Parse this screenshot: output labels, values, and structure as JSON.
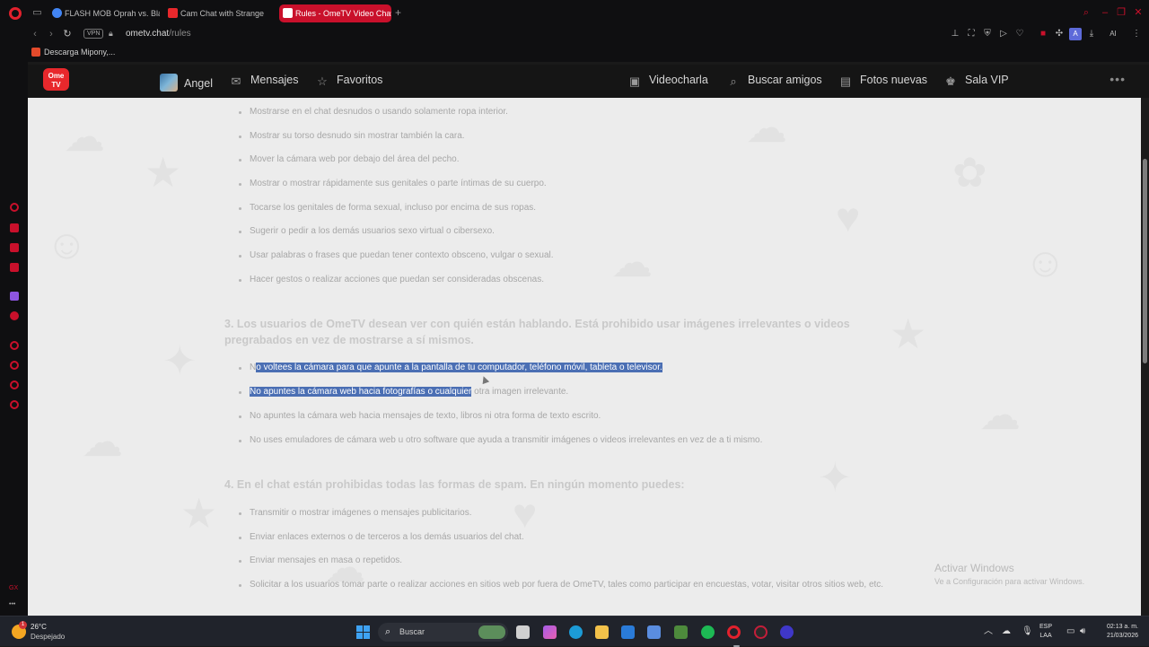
{
  "browser": {
    "tabs": [
      {
        "title": "FLASH MOB Oprah vs. Bla",
        "favicon_color": "#4285f4",
        "active": false
      },
      {
        "title": "Cam Chat with Strange",
        "favicon_color": "#e8282c",
        "active": false
      },
      {
        "title": "Rules - OmeTV Video Chat",
        "favicon_color": "#ffffff",
        "active": true
      }
    ],
    "new_tab": "+",
    "address": {
      "vpn": "VPN",
      "host": "ometv.chat",
      "path": "/rules"
    },
    "bookmark": "Descarga Mipony,...",
    "profile_initial": "A",
    "ai_label": "AI",
    "sidebar_label": "GX"
  },
  "site": {
    "logo": {
      "line1": "Ome",
      "line2": "TV"
    },
    "nav_left": [
      {
        "label": "Angel"
      },
      {
        "label": "Mensajes"
      },
      {
        "label": "Favoritos"
      }
    ],
    "nav_right": [
      {
        "label": "Videocharla"
      },
      {
        "label": "Buscar amigos"
      },
      {
        "label": "Fotos nuevas"
      },
      {
        "label": "Sala VIP"
      }
    ],
    "more": "•••"
  },
  "rules": {
    "list_a": [
      "Mostrarse en el chat desnudos o usando solamente ropa interior.",
      "Mostrar su torso desnudo sin mostrar también la cara.",
      "Mover la cámara web por debajo del área del pecho.",
      "Mostrar o mostrar rápidamente sus genitales o parte íntimas de su cuerpo.",
      "Tocarse los genitales de forma sexual, incluso por encima de sus ropas.",
      "Sugerir o pedir a los demás usuarios sexo virtual o cibersexo.",
      "Usar palabras o frases que puedan tener contexto obsceno, vulgar o sexual.",
      "Hacer gestos o realizar acciones que puedan ser consideradas obscenas."
    ],
    "section3": {
      "line1": "3.  Los usuarios de OmeTV desean ver con quién están hablando. Está prohibido usar imágenes irrelevantes o videos",
      "line2": "pregrabados en vez de mostrarse a sí mismos."
    },
    "list_b": {
      "item1_first": "N",
      "item1_highlight": "o voltees la cámara para que apunte a la pantalla de tu computador, teléfono móvil, tableta o televisor.",
      "item2_highlight": "No apuntes la cámara web hacia fotografías o cualquier",
      "item2_rest": " otra imagen irrelevante.",
      "item3": "No apuntes la cámara web hacia mensajes de texto, libros ni otra forma de texto escrito.",
      "item4": "No uses emuladores de cámara web u otro software que ayuda a transmitir imágenes o videos irrelevantes en vez de a ti mismo."
    },
    "section4": "4.  En el chat están prohibidas todas las formas de spam. En ningún momento puedes:",
    "list_c": [
      "Transmitir o mostrar imágenes o mensajes publicitarios.",
      "Enviar enlaces externos o de terceros a los demás usuarios del chat.",
      "Enviar mensajes en masa o repetidos.",
      "Solicitar a los usuarios tomar parte o realizar acciones en sitios web por fuera de OmeTV, tales como participar en encuestas, votar, visitar otros sitios web, etc."
    ]
  },
  "watermark": {
    "title": "Activar Windows",
    "subtitle": "Ve a Configuración para activar Windows."
  },
  "taskbar": {
    "weather_temp": "26°C",
    "weather_cond": "Despejado",
    "notification_count": "1",
    "search_placeholder": "Buscar",
    "lang_line1": "ESP",
    "lang_line2": "LAA",
    "time": "02:13 a. m.",
    "date": "21/03/2026"
  }
}
